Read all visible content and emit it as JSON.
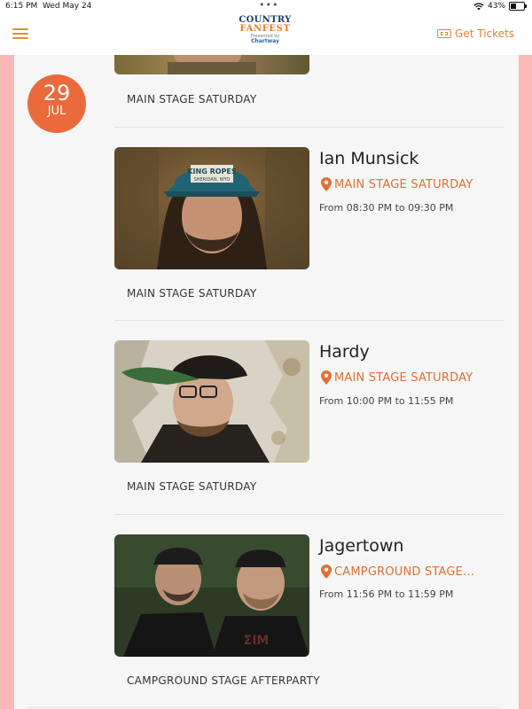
{
  "status_bar": {
    "time": "6:15 PM",
    "date": "Wed May 24",
    "battery": "43%"
  },
  "header": {
    "logo": {
      "line1": "COUNTRY",
      "line2": "FANFEST",
      "line3": "Presented by",
      "line4": "Chartway"
    },
    "tickets_label": "Get Tickets"
  },
  "date_badge": {
    "day": "29",
    "month": "JUL"
  },
  "top_stage_label": "MAIN STAGE SATURDAY",
  "performers": [
    {
      "name": "Ian Munsick",
      "venue": "MAIN STAGE SATURDAY",
      "time": "From 08:30 PM to 09:30 PM",
      "stage": "MAIN STAGE SATURDAY"
    },
    {
      "name": "Hardy",
      "venue": "MAIN STAGE SATURDAY",
      "time": "From 10:00 PM to 11:55 PM",
      "stage": "MAIN STAGE SATURDAY"
    },
    {
      "name": "Jagertown",
      "venue": "CAMPGROUND STAGE...",
      "time": "From 11:56 PM to 11:59 PM",
      "stage": "CAMPGROUND STAGE AFTERPARTY"
    }
  ],
  "colors": {
    "accent": "#e0702f",
    "band": "#fbb8b5",
    "badge": "#ea6a3c"
  },
  "icons": {
    "menu": "hamburger-icon",
    "tickets": "ticket-icon",
    "venue": "location-pin-icon"
  }
}
